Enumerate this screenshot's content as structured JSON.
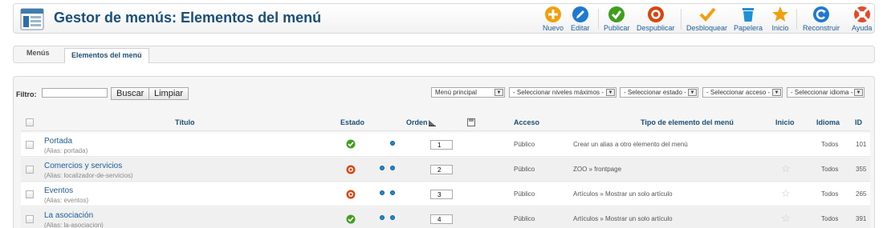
{
  "header": {
    "title": "Gestor de menús: Elementos del menú"
  },
  "toolbar": {
    "nuevo": "Nuevo",
    "editar": "Editar",
    "publicar": "Publicar",
    "despublicar": "Despublicar",
    "desbloquear": "Desbloquear",
    "papelera": "Papelera",
    "inicio": "Inicio",
    "reconstruir": "Reconstruir",
    "ayuda": "Ayuda"
  },
  "tabs": {
    "menus": "Menús",
    "elementos": "Elementos del menú"
  },
  "filter": {
    "label": "Filtro:",
    "value": "",
    "search_button": "Buscar",
    "clear_button": "Limpiar",
    "menu_select": "Menú principal",
    "levels_select": "- Seleccionar niveles máximos -",
    "state_select": "- Seleccionar estado -",
    "access_select": "- Seleccionar acceso -",
    "language_select": "- Seleccionar idioma -"
  },
  "table": {
    "headers": {
      "titulo": "Título",
      "estado": "Estado",
      "orden": "Orden",
      "acceso": "Acceso",
      "tipo": "Tipo de elemento del menú",
      "inicio": "Inicio",
      "idioma": "Idioma",
      "id": "ID"
    },
    "rows": [
      {
        "title": "Portada",
        "alias": "(Alias: portada)",
        "status": "published",
        "order": "1",
        "access": "Público",
        "type": "Crear un alias a otro elemento del menú",
        "home": true,
        "language": "Todos",
        "id": "101"
      },
      {
        "title": "Comercios y servicios",
        "alias": "(Alias: localizador-de-servicios)",
        "status": "unpublished",
        "order": "2",
        "access": "Público",
        "type": "ZOO » frontpage",
        "home": false,
        "language": "Todos",
        "id": "355"
      },
      {
        "title": "Eventos",
        "alias": "(Alias: eventos)",
        "status": "unpublished",
        "order": "3",
        "access": "Público",
        "type": "Artículos » Mostrar un solo artículo",
        "home": false,
        "language": "Todos",
        "id": "265"
      },
      {
        "title": "La asociación",
        "alias": "(Alias: la-asociacion)",
        "status": "published",
        "order": "4",
        "access": "Público",
        "type": "Artículos » Mostrar un solo artículo",
        "home": false,
        "language": "Todos",
        "id": "391"
      }
    ]
  },
  "colors": {
    "accent": "#1a5d9e",
    "published": "#3f9e1e",
    "unpublished": "#d9450f"
  }
}
